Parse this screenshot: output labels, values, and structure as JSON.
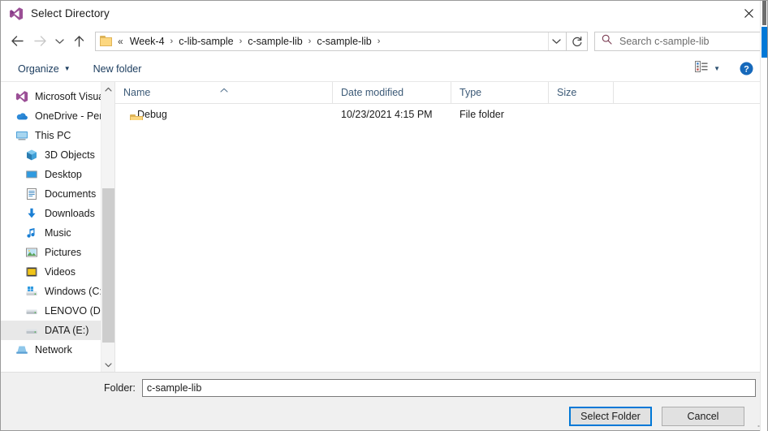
{
  "window": {
    "title": "Select Directory",
    "app_icon": "visual-studio-icon",
    "close_label": "Close"
  },
  "nav": {
    "back": "Back",
    "forward": "Forward",
    "recent": "Recent locations",
    "up": "Up to c-sample-lib",
    "refresh": "Refresh",
    "dropdown": "Previous locations"
  },
  "breadcrumb": {
    "folder_icon": "folder-icon",
    "ellipsis": "«",
    "separator": "›",
    "items": [
      {
        "label": "Week-4"
      },
      {
        "label": "c-lib-sample"
      },
      {
        "label": "c-sample-lib"
      },
      {
        "label": "c-sample-lib"
      }
    ]
  },
  "search": {
    "icon": "search-icon",
    "placeholder": "Search c-sample-lib",
    "value": ""
  },
  "toolbar": {
    "organize_label": "Organize",
    "organize_caret": "▼",
    "new_folder_label": "New folder",
    "view_icon": "view-options-icon",
    "view_caret": "▼",
    "help_icon": "help-icon",
    "help_label": "?"
  },
  "sidebar": {
    "items": [
      {
        "label": "Microsoft Visual S",
        "icon": "visual-studio-icon",
        "indent": false,
        "hovered": false
      },
      {
        "label": "OneDrive - Person",
        "icon": "onedrive-icon",
        "indent": false,
        "hovered": false
      },
      {
        "label": "This PC",
        "icon": "this-pc-icon",
        "indent": false,
        "hovered": false
      },
      {
        "label": "3D Objects",
        "icon": "3d-objects-icon",
        "indent": true,
        "hovered": false
      },
      {
        "label": "Desktop",
        "icon": "desktop-icon",
        "indent": true,
        "hovered": false
      },
      {
        "label": "Documents",
        "icon": "documents-icon",
        "indent": true,
        "hovered": false
      },
      {
        "label": "Downloads",
        "icon": "downloads-icon",
        "indent": true,
        "hovered": false
      },
      {
        "label": "Music",
        "icon": "music-icon",
        "indent": true,
        "hovered": false
      },
      {
        "label": "Pictures",
        "icon": "pictures-icon",
        "indent": true,
        "hovered": false
      },
      {
        "label": "Videos",
        "icon": "videos-icon",
        "indent": true,
        "hovered": false
      },
      {
        "label": "Windows (C:)",
        "icon": "windows-drive-icon",
        "indent": true,
        "hovered": false
      },
      {
        "label": "LENOVO (D:)",
        "icon": "drive-icon",
        "indent": true,
        "hovered": false
      },
      {
        "label": "DATA (E:)",
        "icon": "drive-icon",
        "indent": true,
        "hovered": true
      },
      {
        "label": "Network",
        "icon": "network-icon",
        "indent": false,
        "hovered": false
      }
    ],
    "scroll_up": "⌃",
    "scroll_down": "⌄"
  },
  "filelist": {
    "columns": [
      {
        "key": "name",
        "label": "Name",
        "sorted": true,
        "sort_caret": "˄"
      },
      {
        "key": "date",
        "label": "Date modified",
        "sorted": false
      },
      {
        "key": "type",
        "label": "Type",
        "sorted": false
      },
      {
        "key": "size",
        "label": "Size",
        "sorted": false
      }
    ],
    "rows": [
      {
        "icon": "folder-icon",
        "name": "Debug",
        "date": "10/23/2021 4:15 PM",
        "type": "File folder",
        "size": ""
      }
    ]
  },
  "footer": {
    "folder_label": "Folder:",
    "folder_value": "c-sample-lib",
    "folder_placeholder": "",
    "select_button": "Select Folder",
    "cancel_button": "Cancel",
    "resize_grip": "resize-grip-icon"
  },
  "colors": {
    "accent": "#0078d7",
    "folder_yellow": "#fcd77f",
    "header_text": "#3c5a77",
    "footer_bg": "#f0f0f0"
  }
}
